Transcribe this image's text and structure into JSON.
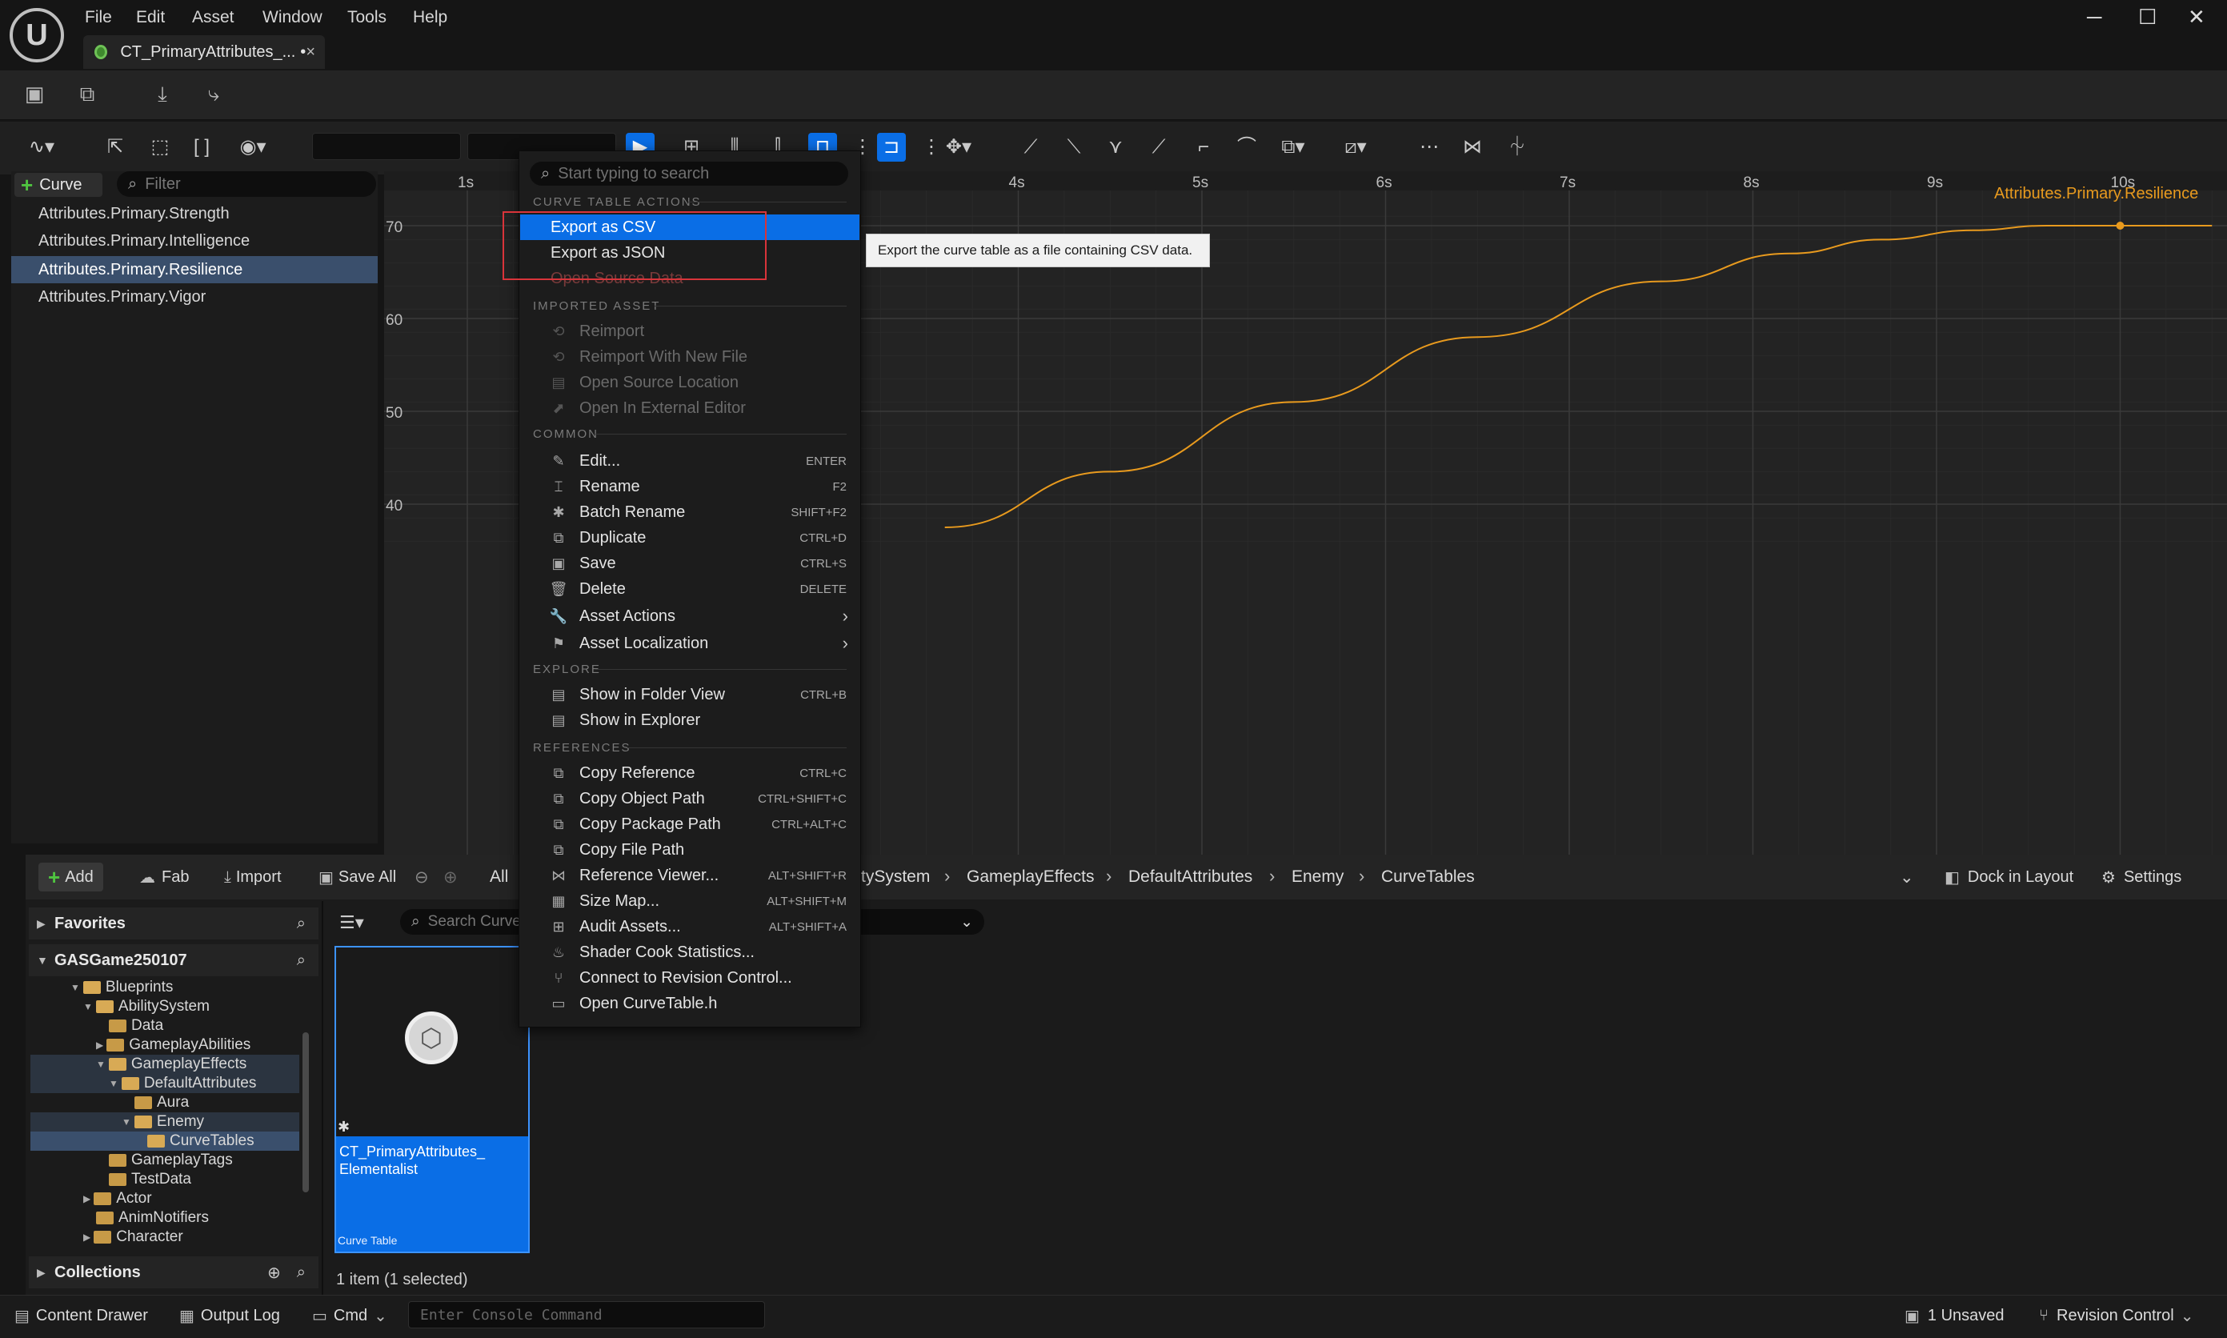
{
  "menu": [
    "File",
    "Edit",
    "Asset",
    "Window",
    "Tools",
    "Help"
  ],
  "tab": {
    "title": "CT_PrimaryAttributes_...",
    "dirty": "•",
    "close": "×"
  },
  "curve_panel": {
    "add_label": "Curve",
    "filter_placeholder": "Filter",
    "items": [
      "Attributes.Primary.Strength",
      "Attributes.Primary.Intelligence",
      "Attributes.Primary.Resilience",
      "Attributes.Primary.Vigor"
    ],
    "selected_index": 2
  },
  "chart_data": {
    "type": "line",
    "series": [
      {
        "name": "Attributes.Primary.Resilience",
        "color": "#e89a1e",
        "x": [
          3.6,
          4.5,
          5.5,
          6.5,
          7.5,
          8.2,
          8.7,
          9.2,
          9.6,
          10.0,
          10.5
        ],
        "y": [
          37.5,
          43.5,
          51.0,
          58.0,
          64.0,
          67.0,
          68.5,
          69.5,
          70.0,
          70.0,
          70.0
        ]
      }
    ],
    "x_ticks": [
      "1s",
      "4s",
      "5s",
      "6s",
      "7s",
      "8s",
      "9s",
      "10s"
    ],
    "y_ticks": [
      "70",
      "60",
      "50",
      "40"
    ],
    "label": "Attributes.Primary.Resilience"
  },
  "context_menu": {
    "search_placeholder": "Start typing to search",
    "sections": {
      "curve_table_actions": "CURVE TABLE ACTIONS",
      "imported_asset": "IMPORTED ASSET",
      "common": "COMMON",
      "explore": "EXPLORE",
      "references": "REFERENCES"
    },
    "curve_table_actions": [
      "Export as CSV",
      "Export as JSON",
      "Open Source Data"
    ],
    "imported_asset": [
      "Reimport",
      "Reimport With New File",
      "Open Source Location",
      "Open In External Editor"
    ],
    "common": [
      {
        "label": "Edit...",
        "shortcut": "ENTER"
      },
      {
        "label": "Rename",
        "shortcut": "F2"
      },
      {
        "label": "Batch Rename",
        "shortcut": "SHIFT+F2"
      },
      {
        "label": "Duplicate",
        "shortcut": "CTRL+D"
      },
      {
        "label": "Save",
        "shortcut": "CTRL+S"
      },
      {
        "label": "Delete",
        "shortcut": "DELETE"
      },
      {
        "label": "Asset Actions",
        "shortcut": ""
      },
      {
        "label": "Asset Localization",
        "shortcut": ""
      }
    ],
    "explore": [
      {
        "label": "Show in Folder View",
        "shortcut": "CTRL+B"
      },
      {
        "label": "Show in Explorer",
        "shortcut": ""
      }
    ],
    "references": [
      {
        "label": "Copy Reference",
        "shortcut": "CTRL+C"
      },
      {
        "label": "Copy Object Path",
        "shortcut": "CTRL+SHIFT+C"
      },
      {
        "label": "Copy Package Path",
        "shortcut": "CTRL+ALT+C"
      },
      {
        "label": "Copy File Path",
        "shortcut": ""
      },
      {
        "label": "Reference Viewer...",
        "shortcut": "ALT+SHIFT+R"
      },
      {
        "label": "Size Map...",
        "shortcut": "ALT+SHIFT+M"
      },
      {
        "label": "Audit Assets...",
        "shortcut": "ALT+SHIFT+A"
      },
      {
        "label": "Shader Cook Statistics...",
        "shortcut": ""
      },
      {
        "label": "Connect to Revision Control...",
        "shortcut": ""
      },
      {
        "label": "Open CurveTable.h",
        "shortcut": ""
      }
    ],
    "tooltip": "Export the curve table as a file containing CSV data."
  },
  "content_browser": {
    "add": "Add",
    "fab": "Fab",
    "import": "Import",
    "save_all": "Save All",
    "all": "All",
    "breadcrumbs": [
      "tySystem",
      "GameplayEffects",
      "DefaultAttributes",
      "Enemy",
      "CurveTables"
    ],
    "dock_in_layout": "Dock in Layout",
    "settings": "Settings",
    "favorites": "Favorites",
    "project": "GASGame250107",
    "collections": "Collections",
    "search_placeholder": "Search CurveT",
    "tree": [
      "Blueprints",
      "AbilitySystem",
      "Data",
      "GameplayAbilities",
      "GameplayEffects",
      "DefaultAttributes",
      "Aura",
      "Enemy",
      "CurveTables",
      "GameplayTags",
      "TestData",
      "Actor",
      "AnimNotifiers",
      "Character"
    ],
    "asset": {
      "name": "CT_PrimaryAttributes_ Elementalist",
      "type": "Curve Table"
    },
    "item_count": "1 item (1 selected)"
  },
  "statusbar": {
    "content_drawer": "Content Drawer",
    "output_log": "Output Log",
    "cmd": "Cmd",
    "console_placeholder": "Enter Console Command",
    "unsaved": "1 Unsaved",
    "revision_control": "Revision Control"
  }
}
